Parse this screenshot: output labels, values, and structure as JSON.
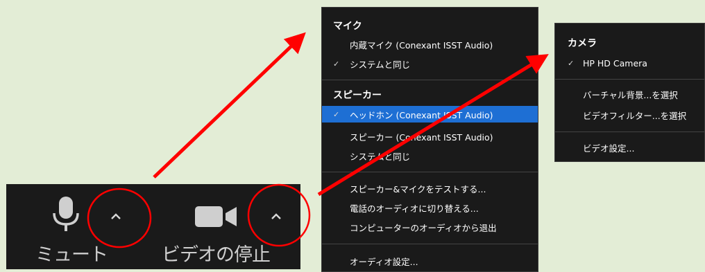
{
  "toolbar": {
    "mute_label": "ミュート",
    "stop_video_label": "ビデオの停止",
    "mic_icon": "microphone-icon",
    "camera_icon": "video-camera-icon",
    "caret_icon": "chevron-up-icon"
  },
  "audio_menu": {
    "mic_header": "マイク",
    "mic_items": [
      {
        "label": "内蔵マイク (Conexant ISST Audio)",
        "checked": false
      },
      {
        "label": "システムと同じ",
        "checked": true
      }
    ],
    "speaker_header": "スピーカー",
    "speaker_items": [
      {
        "label": "ヘッドホン (Conexant ISST Audio)",
        "checked": true,
        "selected": true
      },
      {
        "label": "スピーカー (Conexant ISST Audio)",
        "checked": false
      },
      {
        "label": "システムと同じ",
        "checked": false
      }
    ],
    "actions": [
      "スピーカー&マイクをテストする...",
      "電話のオーディオに切り替える...",
      "コンピューターのオーディオから退出"
    ],
    "settings": "オーディオ設定...",
    "check_mark": "✓"
  },
  "video_menu": {
    "camera_header": "カメラ",
    "camera_items": [
      {
        "label": "HP HD Camera",
        "checked": true
      }
    ],
    "actions": [
      "バーチャル背景...を選択",
      "ビデオフィルター...を選択"
    ],
    "settings": "ビデオ設定..."
  },
  "colors": {
    "background": "#e3edd6",
    "menu_bg": "#1a1a1a",
    "highlight": "#1e6fd4",
    "annotation": "#ff0000"
  }
}
